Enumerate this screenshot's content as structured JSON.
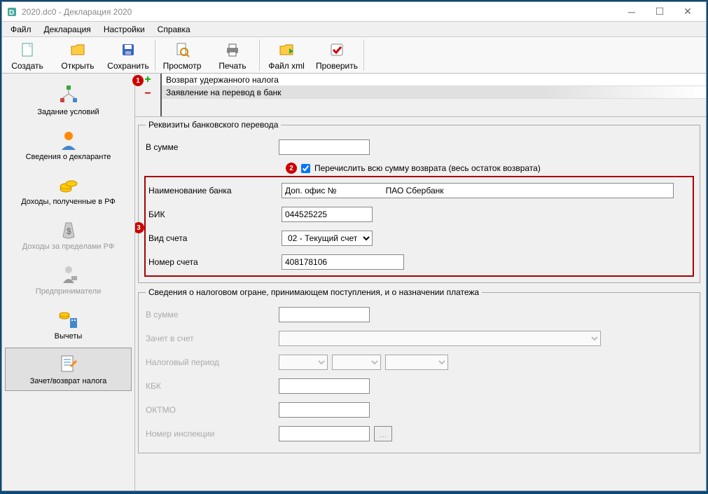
{
  "window": {
    "title": "2020.dc0 - Декларация 2020"
  },
  "menu": {
    "file": "Файл",
    "decl": "Декларация",
    "settings": "Настройки",
    "help": "Справка"
  },
  "toolbar": {
    "create": "Создать",
    "open": "Открыть",
    "save": "Сохранить",
    "preview": "Просмотр",
    "print": "Печать",
    "xml": "Файл xml",
    "check": "Проверить"
  },
  "sidebar": {
    "items": [
      {
        "label": "Задание условий"
      },
      {
        "label": "Сведения о декларанте"
      },
      {
        "label": "Доходы, полученные в РФ"
      },
      {
        "label": "Доходы за пределами РФ"
      },
      {
        "label": "Предприниматели"
      },
      {
        "label": "Вычеты"
      },
      {
        "label": "Зачет/возврат налога"
      }
    ]
  },
  "lists": {
    "row1": "Возврат удержанного налога",
    "row2": "Заявление на перевод в банк"
  },
  "badges": {
    "b1": "1",
    "b2": "2",
    "b3": "3"
  },
  "form1": {
    "legend": "Реквизиты банковского перевода",
    "sum_label": "В сумме",
    "sum_value": "",
    "cb_label": "Перечислить всю сумму возврата (весь остаток возврата)",
    "bank_label": "Наименование банка",
    "bank_value": "Доп. офис №                     ПАО Сбербанк",
    "bik_label": "БИК",
    "bik_value": "044525225",
    "acct_type_label": "Вид счета",
    "acct_type_value": "02 - Текущий счет",
    "acct_num_label": "Номер счета",
    "acct_num_value": "408178106"
  },
  "form2": {
    "legend": "Сведения о налоговом огране, принимающем поступления, и о назначении платежа",
    "sum_label": "В сумме",
    "credit_label": "Зачет в счет",
    "period_label": "Налоговый период",
    "kbk_label": "КБК",
    "oktmo_label": "ОКТМО",
    "insp_label": "Номер инспекции"
  }
}
